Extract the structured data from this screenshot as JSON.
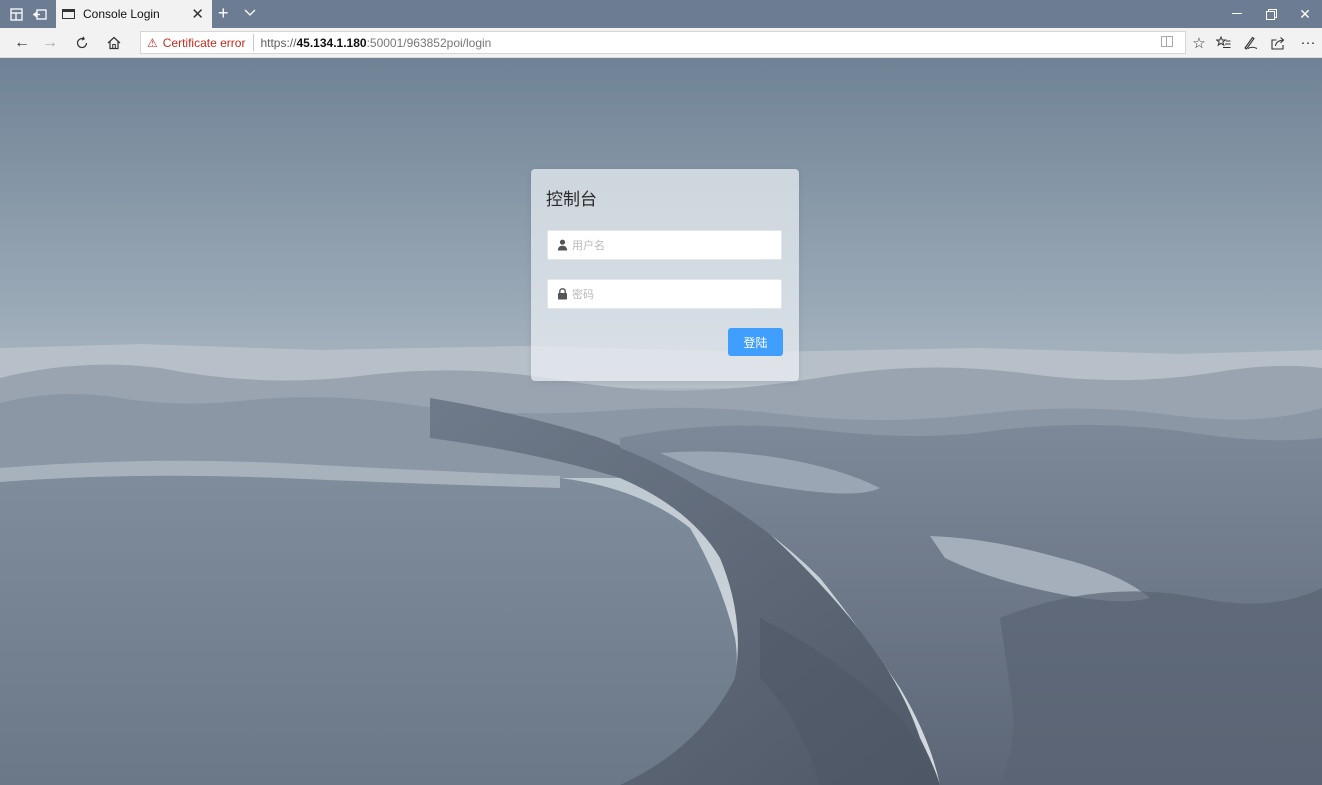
{
  "browser": {
    "tab": {
      "title": "Console Login"
    },
    "address": {
      "cert_warning": "Certificate error",
      "url_scheme": "https://",
      "url_host": "45.134.1.180",
      "url_rest": ":50001/963852poi/login"
    },
    "icons": {
      "back": "arrow-left-icon",
      "forward": "arrow-right-icon",
      "refresh": "refresh-icon",
      "home": "home-icon",
      "favorite": "star-icon",
      "favorites_list": "favorites-icon",
      "notes": "pen-icon",
      "share": "share-icon",
      "more": "ellipsis-icon"
    }
  },
  "login": {
    "title": "控制台",
    "username_placeholder": "用户名",
    "password_placeholder": "密码",
    "submit_label": "登陆",
    "accent_color": "#409eff"
  }
}
